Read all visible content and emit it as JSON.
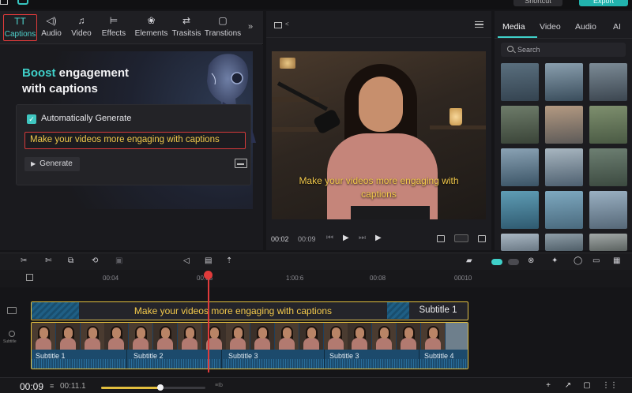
{
  "topbar": {
    "shortcut_label": "Shortcut",
    "export_label": "Export"
  },
  "left_tabs": [
    {
      "label": "Captions",
      "icon": "captions-icon",
      "glyph": "TT",
      "active": true
    },
    {
      "label": "Audio",
      "icon": "audio-icon",
      "glyph": "◁)"
    },
    {
      "label": "Video",
      "icon": "music-note-icon",
      "glyph": "♫"
    },
    {
      "label": "Effects",
      "icon": "effects-icon",
      "glyph": "⊨"
    },
    {
      "label": "Elements",
      "icon": "elements-icon",
      "glyph": "❀"
    },
    {
      "label": "Trasitsis",
      "icon": "transitions-icon",
      "glyph": "⇄"
    },
    {
      "label": "Transtions",
      "icon": "transitions-box-icon",
      "glyph": "▢"
    }
  ],
  "tabs_more_glyph": "»",
  "hero": {
    "title_accent": "Boost",
    "title_rest": " engagement",
    "title_line2": "with captions"
  },
  "auto_generate": {
    "checked_glyph": "✓",
    "label": "Automatically Generate"
  },
  "caption_input": {
    "value": "Make your videos more engaging with captions"
  },
  "generate_button": {
    "play_glyph": "▶",
    "label": "Generate"
  },
  "preview": {
    "ratio_caret": "<",
    "caption_line1": "Make your videos more engaging with",
    "caption_line2": "captions",
    "time_current": "00:02",
    "time_total": "00:09",
    "prev_glyph": "⏮",
    "play_glyph": "▶",
    "next_glyph": "⏭",
    "play2_glyph": "▶"
  },
  "media": {
    "tabs": [
      {
        "label": "Media",
        "active": true
      },
      {
        "label": "Video"
      },
      {
        "label": "Audio"
      },
      {
        "label": "AI"
      }
    ],
    "search_placeholder": "Search",
    "thumb_colors": [
      [
        "#5a6f7e",
        "#344350"
      ],
      [
        "#8a9fae",
        "#3a4d5c"
      ],
      [
        "#7c8b96",
        "#3c4650"
      ],
      [
        "#6e7c6a",
        "#3a4438"
      ],
      [
        "#b49a82",
        "#5d5a58"
      ],
      [
        "#7e8f6e",
        "#4a5a44"
      ],
      [
        "#8aa2b4",
        "#3b5466"
      ],
      [
        "#a8b6c0",
        "#4e6070"
      ],
      [
        "#6d7f72",
        "#3c4a40"
      ],
      [
        "#5f9db5",
        "#2f5a70"
      ],
      [
        "#7ea9c0",
        "#4a6a7e"
      ],
      [
        "#9ab0c2",
        "#566878"
      ],
      [
        "#aab8c4",
        "#6a7884"
      ],
      [
        "#8f9ea8",
        "#4f5e68"
      ],
      [
        "#a3a9a8",
        "#5b6260"
      ]
    ]
  },
  "toolbar": {
    "split_glyph": "✂",
    "cut_glyph": "✄",
    "copy_glyph": "⧉",
    "loop_glyph": "⟲",
    "crop_glyph": "▣",
    "audio_glyph": "◁",
    "caption_glyph": "▤",
    "magnet_glyph": "⇡",
    "folder_glyph": "▰",
    "link_glyph": "⊗",
    "star_glyph": "✦",
    "chat_glyph": "◯",
    "screen_glyph": "▭",
    "grid_glyph": "▦"
  },
  "ruler": {
    "labels": [
      "00:04",
      "00:08",
      "1:00:6",
      "00:08",
      "00010"
    ]
  },
  "timeline": {
    "caption_clip_text": "Make your videos more engaging with captions",
    "caption_clip_label": "Subtitle 1",
    "track_side_label": "Subtitle",
    "segments": [
      "Subtitle 1",
      "Subtitle 2",
      "Subtitle 3",
      "Subtitle 3",
      "Subtitle 4"
    ]
  },
  "playback": {
    "current": "00:09",
    "eq_glyph": "≡",
    "total": "00:11.1",
    "zoom_fraction": 0.57,
    "zoom_label": "≡Ib",
    "add_glyph": "+",
    "share_glyph": "↗",
    "chat_glyph": "▢",
    "menu_glyph": "⋮⋮"
  }
}
